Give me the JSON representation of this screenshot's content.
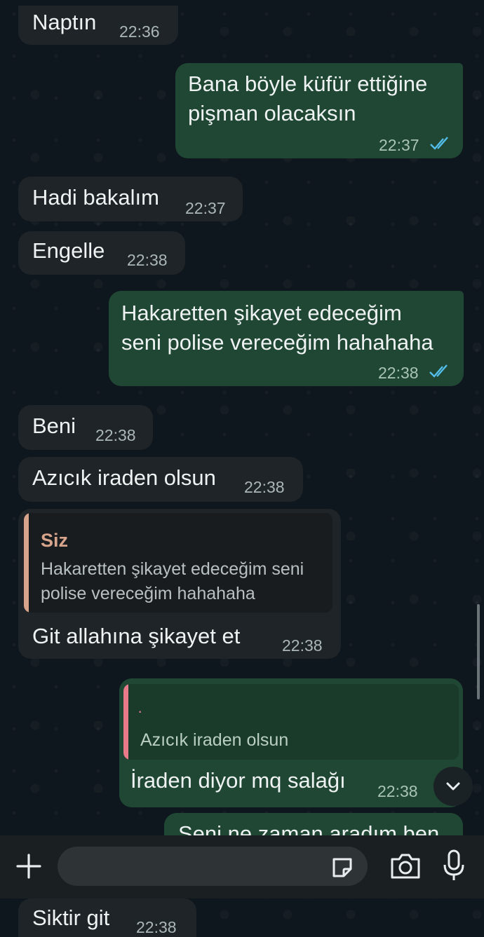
{
  "messages": [
    {
      "text": "Naptın",
      "time": "22:36"
    },
    {
      "lines": [
        "Bana böyle küfür ettiğine",
        "pişman olacaksın"
      ],
      "time": "22:37"
    },
    {
      "text": "Hadi bakalım",
      "time": "22:37"
    },
    {
      "text": "Engelle",
      "time": "22:38"
    },
    {
      "lines": [
        "Hakaretten şikayet edeceğim",
        "seni polise vereceğim hahahaha"
      ],
      "time": "22:38"
    },
    {
      "text": "Beni",
      "time": "22:38"
    },
    {
      "text": "Azıcık iraden olsun",
      "time": "22:38"
    },
    {
      "quote": {
        "author": "Siz",
        "lines": [
          "Hakaretten şikayet edeceğim seni",
          "polise vereceğim hahahaha"
        ]
      },
      "text": "Git allahına şikayet et",
      "time": "22:38"
    },
    {
      "quote": {
        "author": "·",
        "lines": [
          "Azıcık iraden olsun"
        ]
      },
      "text": "İraden diyor mq salağı",
      "time": "22:38"
    },
    {
      "text": "Seni ne zaman aradım ben",
      "time": ""
    },
    {
      "text": "Siktir git",
      "time": "22:38"
    }
  ],
  "composer": {
    "placeholder": "",
    "icons": [
      "plus-icon",
      "sticker-icon",
      "camera-icon",
      "microphone-icon"
    ]
  },
  "scroll_down_icon": "chevron-down-icon",
  "colors": {
    "background": "#0b141a",
    "incoming": "#1f2428",
    "outgoing": "#1f4733",
    "read_ticks": "#53bdeb",
    "quote_author_siz": "#d9a48c",
    "quote_bar_siz": "#d9a48c",
    "quote_bar_other": "#e87a8a"
  }
}
